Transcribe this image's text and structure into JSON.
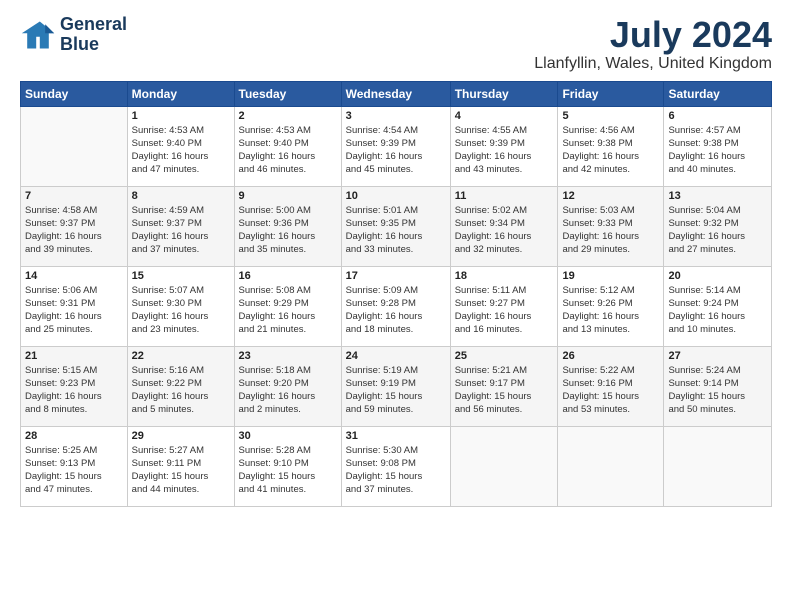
{
  "header": {
    "logo_line1": "General",
    "logo_line2": "Blue",
    "month_title": "July 2024",
    "location": "Llanfyllin, Wales, United Kingdom"
  },
  "days_of_week": [
    "Sunday",
    "Monday",
    "Tuesday",
    "Wednesday",
    "Thursday",
    "Friday",
    "Saturday"
  ],
  "weeks": [
    [
      {
        "day": "",
        "info": ""
      },
      {
        "day": "1",
        "info": "Sunrise: 4:53 AM\nSunset: 9:40 PM\nDaylight: 16 hours\nand 47 minutes."
      },
      {
        "day": "2",
        "info": "Sunrise: 4:53 AM\nSunset: 9:40 PM\nDaylight: 16 hours\nand 46 minutes."
      },
      {
        "day": "3",
        "info": "Sunrise: 4:54 AM\nSunset: 9:39 PM\nDaylight: 16 hours\nand 45 minutes."
      },
      {
        "day": "4",
        "info": "Sunrise: 4:55 AM\nSunset: 9:39 PM\nDaylight: 16 hours\nand 43 minutes."
      },
      {
        "day": "5",
        "info": "Sunrise: 4:56 AM\nSunset: 9:38 PM\nDaylight: 16 hours\nand 42 minutes."
      },
      {
        "day": "6",
        "info": "Sunrise: 4:57 AM\nSunset: 9:38 PM\nDaylight: 16 hours\nand 40 minutes."
      }
    ],
    [
      {
        "day": "7",
        "info": "Sunrise: 4:58 AM\nSunset: 9:37 PM\nDaylight: 16 hours\nand 39 minutes."
      },
      {
        "day": "8",
        "info": "Sunrise: 4:59 AM\nSunset: 9:37 PM\nDaylight: 16 hours\nand 37 minutes."
      },
      {
        "day": "9",
        "info": "Sunrise: 5:00 AM\nSunset: 9:36 PM\nDaylight: 16 hours\nand 35 minutes."
      },
      {
        "day": "10",
        "info": "Sunrise: 5:01 AM\nSunset: 9:35 PM\nDaylight: 16 hours\nand 33 minutes."
      },
      {
        "day": "11",
        "info": "Sunrise: 5:02 AM\nSunset: 9:34 PM\nDaylight: 16 hours\nand 32 minutes."
      },
      {
        "day": "12",
        "info": "Sunrise: 5:03 AM\nSunset: 9:33 PM\nDaylight: 16 hours\nand 29 minutes."
      },
      {
        "day": "13",
        "info": "Sunrise: 5:04 AM\nSunset: 9:32 PM\nDaylight: 16 hours\nand 27 minutes."
      }
    ],
    [
      {
        "day": "14",
        "info": "Sunrise: 5:06 AM\nSunset: 9:31 PM\nDaylight: 16 hours\nand 25 minutes."
      },
      {
        "day": "15",
        "info": "Sunrise: 5:07 AM\nSunset: 9:30 PM\nDaylight: 16 hours\nand 23 minutes."
      },
      {
        "day": "16",
        "info": "Sunrise: 5:08 AM\nSunset: 9:29 PM\nDaylight: 16 hours\nand 21 minutes."
      },
      {
        "day": "17",
        "info": "Sunrise: 5:09 AM\nSunset: 9:28 PM\nDaylight: 16 hours\nand 18 minutes."
      },
      {
        "day": "18",
        "info": "Sunrise: 5:11 AM\nSunset: 9:27 PM\nDaylight: 16 hours\nand 16 minutes."
      },
      {
        "day": "19",
        "info": "Sunrise: 5:12 AM\nSunset: 9:26 PM\nDaylight: 16 hours\nand 13 minutes."
      },
      {
        "day": "20",
        "info": "Sunrise: 5:14 AM\nSunset: 9:24 PM\nDaylight: 16 hours\nand 10 minutes."
      }
    ],
    [
      {
        "day": "21",
        "info": "Sunrise: 5:15 AM\nSunset: 9:23 PM\nDaylight: 16 hours\nand 8 minutes."
      },
      {
        "day": "22",
        "info": "Sunrise: 5:16 AM\nSunset: 9:22 PM\nDaylight: 16 hours\nand 5 minutes."
      },
      {
        "day": "23",
        "info": "Sunrise: 5:18 AM\nSunset: 9:20 PM\nDaylight: 16 hours\nand 2 minutes."
      },
      {
        "day": "24",
        "info": "Sunrise: 5:19 AM\nSunset: 9:19 PM\nDaylight: 15 hours\nand 59 minutes."
      },
      {
        "day": "25",
        "info": "Sunrise: 5:21 AM\nSunset: 9:17 PM\nDaylight: 15 hours\nand 56 minutes."
      },
      {
        "day": "26",
        "info": "Sunrise: 5:22 AM\nSunset: 9:16 PM\nDaylight: 15 hours\nand 53 minutes."
      },
      {
        "day": "27",
        "info": "Sunrise: 5:24 AM\nSunset: 9:14 PM\nDaylight: 15 hours\nand 50 minutes."
      }
    ],
    [
      {
        "day": "28",
        "info": "Sunrise: 5:25 AM\nSunset: 9:13 PM\nDaylight: 15 hours\nand 47 minutes."
      },
      {
        "day": "29",
        "info": "Sunrise: 5:27 AM\nSunset: 9:11 PM\nDaylight: 15 hours\nand 44 minutes."
      },
      {
        "day": "30",
        "info": "Sunrise: 5:28 AM\nSunset: 9:10 PM\nDaylight: 15 hours\nand 41 minutes."
      },
      {
        "day": "31",
        "info": "Sunrise: 5:30 AM\nSunset: 9:08 PM\nDaylight: 15 hours\nand 37 minutes."
      },
      {
        "day": "",
        "info": ""
      },
      {
        "day": "",
        "info": ""
      },
      {
        "day": "",
        "info": ""
      }
    ]
  ]
}
